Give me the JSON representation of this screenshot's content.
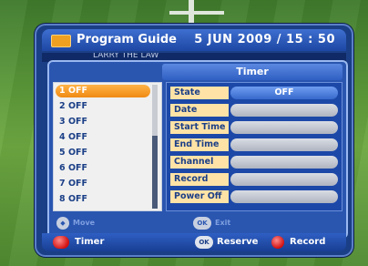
{
  "header": {
    "title": "Program Guide",
    "datetime": "5 JUN 2009 / 15 : 50"
  },
  "epg": {
    "left_text": "LARRY THE LAW",
    "right_text": ""
  },
  "dialog": {
    "title": "Timer"
  },
  "timers": [
    {
      "index": "1",
      "status": "OFF"
    },
    {
      "index": "2",
      "status": "OFF"
    },
    {
      "index": "3",
      "status": "OFF"
    },
    {
      "index": "4",
      "status": "OFF"
    },
    {
      "index": "5",
      "status": "OFF"
    },
    {
      "index": "6",
      "status": "OFF"
    },
    {
      "index": "7",
      "status": "OFF"
    },
    {
      "index": "8",
      "status": "OFF"
    }
  ],
  "details": {
    "state_label": "State",
    "state_value": "OFF",
    "date_label": "Date",
    "date_value": "",
    "start_label": "Start Time",
    "start_value": "",
    "end_label": "End Time",
    "end_value": "",
    "channel_label": "Channel",
    "channel_value": "",
    "record_label": "Record",
    "record_value": "",
    "power_label": "Power Off",
    "power_value": ""
  },
  "hints": {
    "move_btn": "◆",
    "move_label": "Move",
    "ok_btn": "OK",
    "exit_label": "Exit"
  },
  "footer": {
    "timer_label": "Timer",
    "ok_btn": "OK",
    "reserve_label": "Reserve",
    "record_label": "Record"
  },
  "colors": {
    "selected": "#f08a14",
    "panel": "#1b3f87",
    "red": "#d21010"
  }
}
